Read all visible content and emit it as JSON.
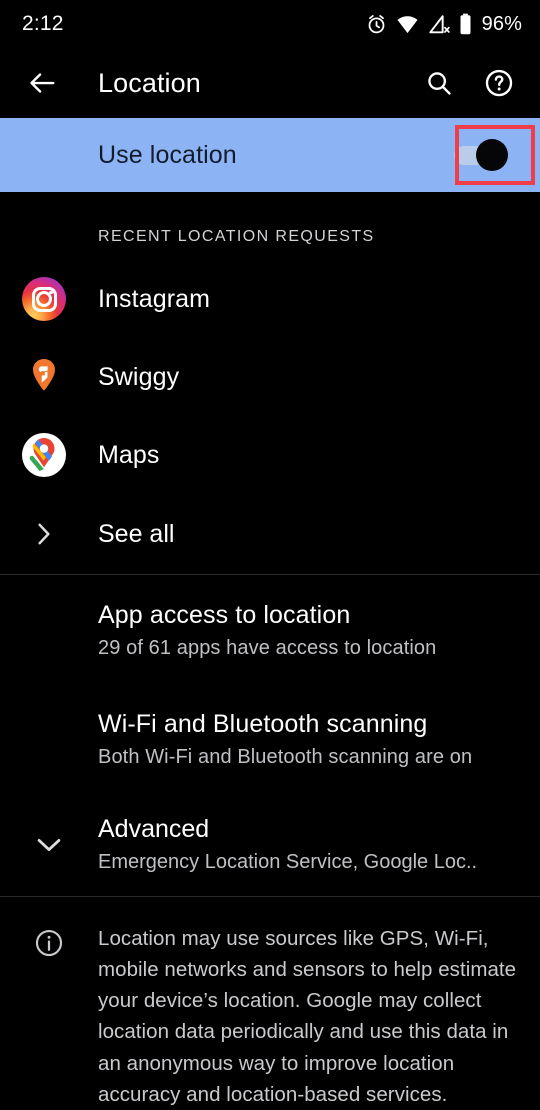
{
  "statusbar": {
    "time": "2:12",
    "battery": "96%",
    "icons": [
      "alarm-icon",
      "wifi-icon",
      "mobile-signal-off-icon",
      "battery-icon"
    ]
  },
  "appbar": {
    "title": "Location",
    "back_icon": "arrow-back-icon",
    "search_icon": "search-icon",
    "help_icon": "help-circle-icon"
  },
  "use_location": {
    "label": "Use location",
    "toggle_state": "on",
    "highlight_color": "#ef3e4a",
    "row_color": "#8cb4f5"
  },
  "recent": {
    "header": "RECENT LOCATION REQUESTS",
    "apps": [
      {
        "name": "Instagram",
        "icon": "instagram-icon"
      },
      {
        "name": "Swiggy",
        "icon": "swiggy-icon"
      },
      {
        "name": "Maps",
        "icon": "google-maps-icon"
      }
    ],
    "see_all": "See all"
  },
  "settings": [
    {
      "title": "App access to location",
      "subtitle": "29 of 61 apps have access to location"
    },
    {
      "title": "Wi-Fi and Bluetooth scanning",
      "subtitle": "Both Wi-Fi and Bluetooth scanning are on"
    }
  ],
  "advanced": {
    "title": "Advanced",
    "subtitle": "Emergency Location Service, Google Loc..",
    "icon": "chevron-down-icon"
  },
  "footer": {
    "icon": "info-icon",
    "text": "Location may use sources like GPS, Wi-Fi, mobile networks and sensors to help estimate your device’s location. Google may collect location data periodically and use this data in an anonymous way to improve location accuracy and location-based services."
  }
}
